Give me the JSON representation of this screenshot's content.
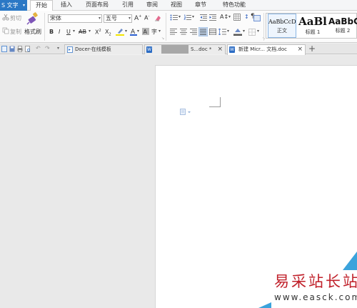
{
  "app": {
    "name": "S 文字",
    "menu_arrow": "▾"
  },
  "menu_tabs": [
    "开始",
    "插入",
    "页面布局",
    "引用",
    "审阅",
    "视图",
    "章节",
    "特色功能"
  ],
  "ribbon": {
    "clipboard": {
      "cut": "剪切",
      "copy": "复制",
      "format_painter": "格式刷"
    },
    "font": {
      "name": "宋体",
      "size": "五号"
    },
    "styles": [
      {
        "preview": "AaBbCcDd",
        "name": "正文"
      },
      {
        "preview": "AaBl",
        "name": "标题 1"
      },
      {
        "preview": "AaBbC",
        "name": "标题 2"
      }
    ],
    "colors": {
      "accent": "#2b78c5",
      "font_color_bar": "#2b5fcf",
      "highlight_bar": "#f2e400"
    }
  },
  "tabs": [
    {
      "label": "Docer-在线模板",
      "active": false
    },
    {
      "label": "S...doc *",
      "active": false
    },
    {
      "label": "新建 Micr... 文档.doc",
      "active": true
    }
  ],
  "tab_close": "×",
  "tab_add": "+",
  "watermark": {
    "title": "易采站长站",
    "url": "www.easck.com"
  }
}
